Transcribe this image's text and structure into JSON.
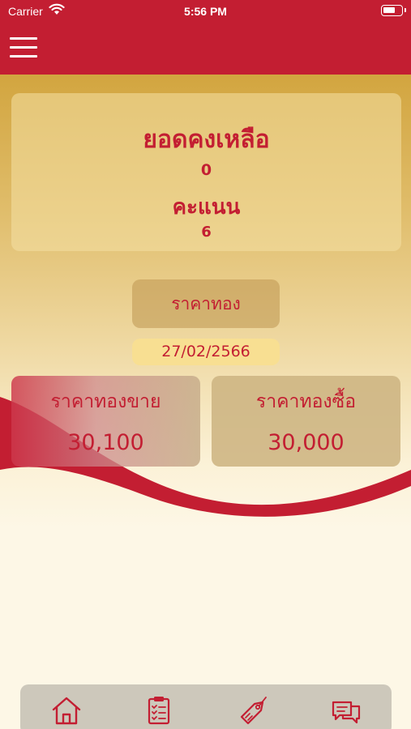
{
  "status_bar": {
    "carrier": "Carrier",
    "time": "5:56 PM"
  },
  "balance_card": {
    "title": "ยอดคงเหลือ",
    "balance": "0",
    "points_label": "คะแนน",
    "points": "6"
  },
  "gold_price_button": {
    "label": "ราคาทอง"
  },
  "date": "27/02/2566",
  "sell_card": {
    "label": "ราคาทองขาย",
    "value": "30,100"
  },
  "buy_card": {
    "label": "ราคาทองซื้อ",
    "value": "30,000"
  },
  "tab_bar": {
    "tabs": [
      "home-icon",
      "clipboard-checklist-icon",
      "price-tag-icon",
      "chat-bubbles-icon"
    ]
  },
  "colors": {
    "brand_red": "#c31e32",
    "gold": "#d2a53f",
    "cream": "#fdf7e6"
  }
}
